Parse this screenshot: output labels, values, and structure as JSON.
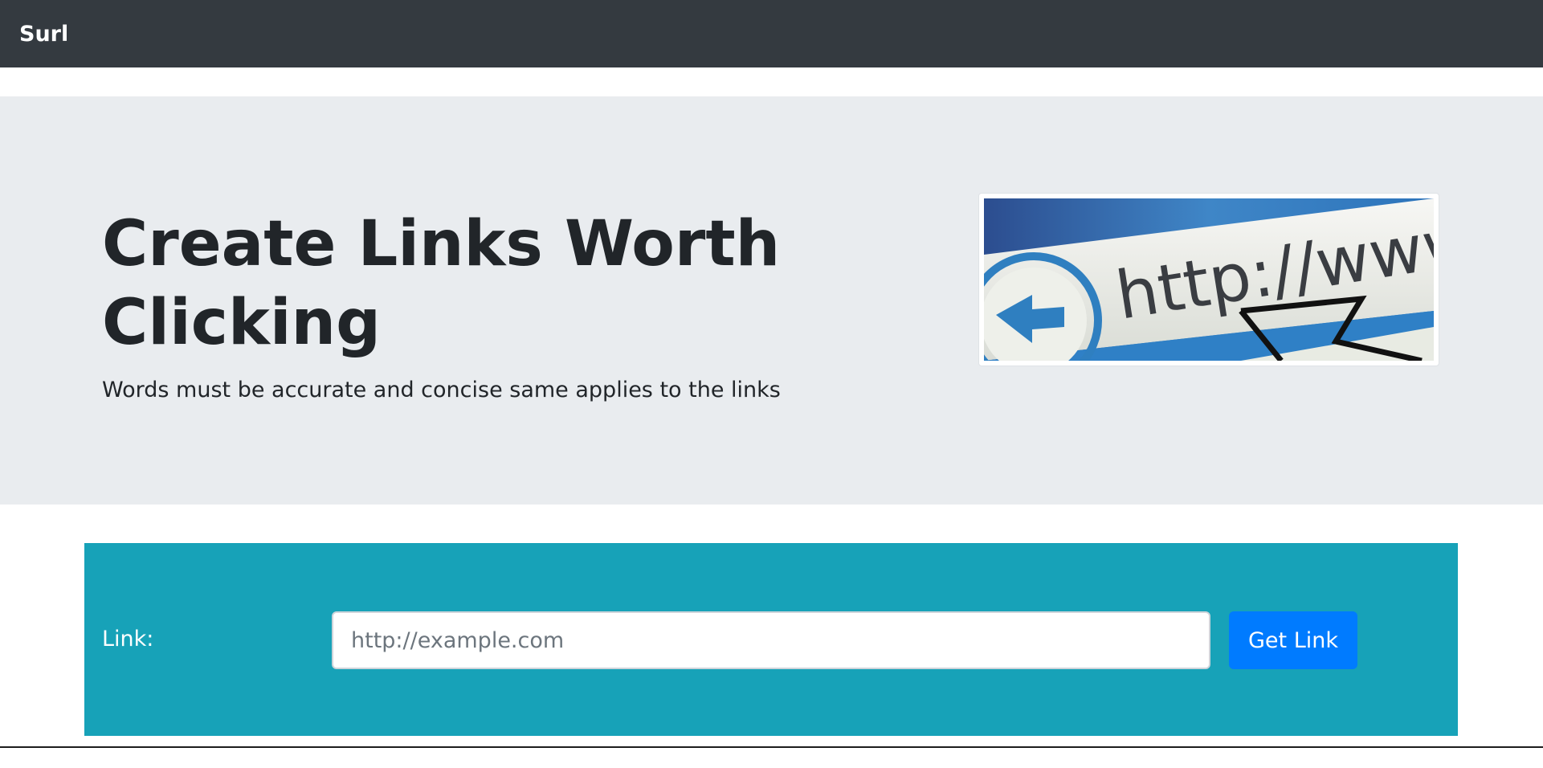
{
  "navbar": {
    "brand": "Surl",
    "background": "#343a40"
  },
  "hero": {
    "title": "Create Links Worth Clicking",
    "lead": "Words must be accurate and concise same applies to the links",
    "background": "#e9ecef",
    "image": {
      "text": "http://www.",
      "icon": "browser-back-arrow-icon",
      "cursor_icon": "mouse-pointer-icon"
    }
  },
  "link_form": {
    "label": "Link:",
    "input_value": "",
    "input_placeholder": "http://example.com",
    "button_label": "Get Link",
    "panel_color": "#17a2b8",
    "button_color": "#007bff"
  }
}
